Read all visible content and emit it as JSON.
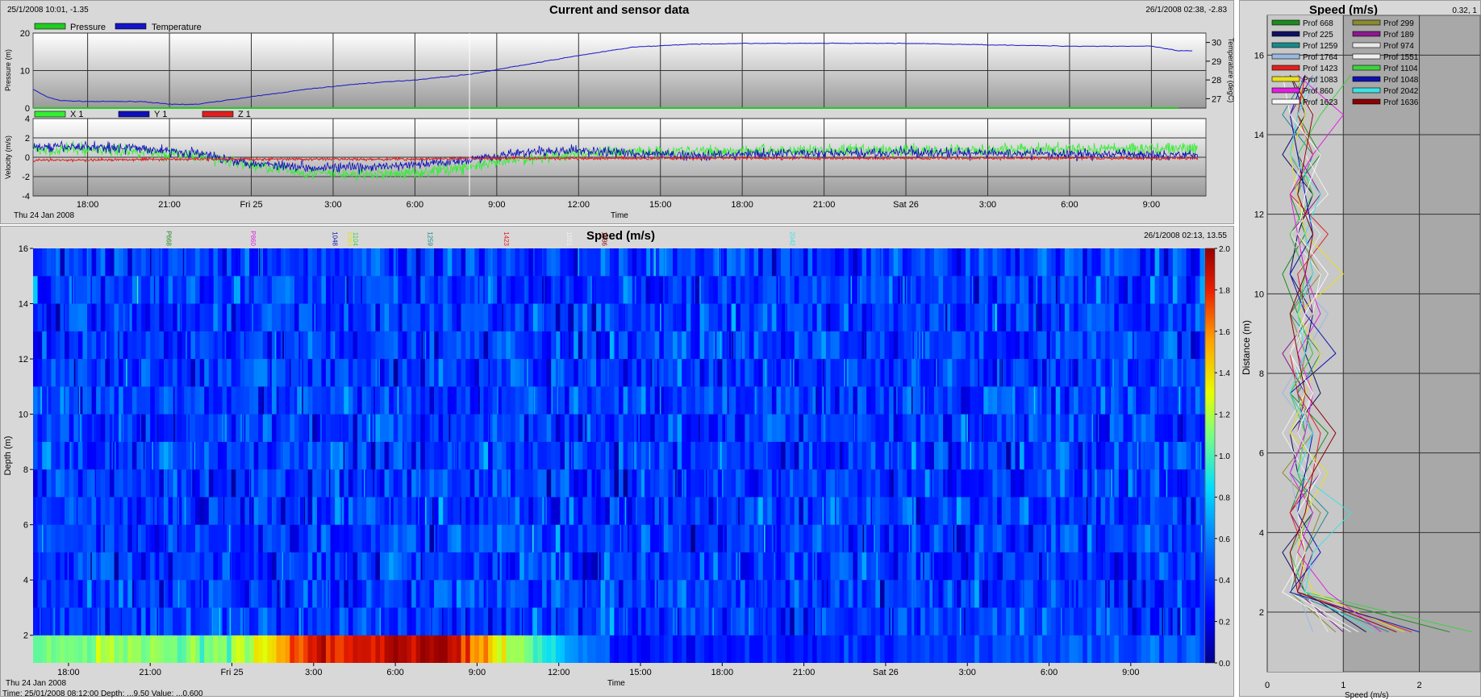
{
  "sensor_panel": {
    "title": "Current and sensor data",
    "readout_left": "25/1/2008 10:01, -1.35",
    "readout_right": "26/1/2008 02:38, -2.83",
    "date_label": "Thu 24 Jan 2008",
    "xlabel": "Time"
  },
  "speed_panel": {
    "title": "Speed (m/s)",
    "readout_right": "26/1/2008 02:13, 13.55",
    "date_label": "Thu 24 Jan 2008",
    "xlabel": "Time",
    "status": "Time: 25/01/2008 08:12:00  Depth: ...9.50  Value: ...0.600"
  },
  "profile_panel": {
    "title": "Speed (m/s)",
    "readout_right": "0.32, 1",
    "xlabel": "Speed (m/s)"
  },
  "colors": {
    "pressure": "#22cc22",
    "temperature": "#1515c8",
    "x1": "#33ee33",
    "y1": "#1010b8",
    "z1": "#e02020"
  },
  "chart_data": [
    {
      "type": "line",
      "name": "pressure-temperature",
      "title": "Current and sensor data",
      "xlabel": "",
      "ylabel": "Pressure (m)",
      "y2label": "Temperature (degC)",
      "ylim": [
        0,
        20
      ],
      "y2lim": [
        26.5,
        30.5
      ],
      "yticks": [
        0,
        10,
        20
      ],
      "y2ticks": [
        27,
        28,
        29,
        30
      ],
      "x_hours": [
        0,
        0.5,
        1,
        2,
        3,
        4,
        5,
        6,
        8,
        10,
        12,
        14,
        16,
        18,
        20,
        22,
        24,
        26,
        28,
        30,
        32,
        34,
        36,
        38,
        40,
        41,
        42
      ],
      "series": [
        {
          "name": "Pressure",
          "values": [
            0,
            0,
            0,
            0,
            0,
            0,
            0,
            0,
            0,
            0,
            0,
            0,
            0,
            0,
            0,
            0,
            0,
            0,
            0,
            0,
            0,
            0,
            0,
            0,
            0,
            0,
            0
          ]
        },
        {
          "name": "Temperature",
          "values": [
            27.5,
            27.1,
            26.9,
            26.85,
            26.85,
            26.85,
            26.7,
            26.7,
            27.1,
            27.5,
            27.8,
            28.0,
            28.3,
            28.8,
            29.3,
            29.75,
            29.9,
            29.95,
            29.95,
            29.95,
            29.95,
            29.9,
            29.85,
            29.8,
            29.8,
            29.8,
            29.55
          ]
        }
      ],
      "legend": "top-left"
    },
    {
      "type": "line",
      "name": "velocity",
      "xlabel": "Time",
      "ylabel": "Velocity (m/s)",
      "ylim": [
        -4,
        4
      ],
      "yticks": [
        -4,
        -2,
        0,
        2,
        4
      ],
      "x_hours": [
        0,
        2,
        4,
        6,
        8,
        10,
        12,
        14,
        16,
        18,
        20,
        22,
        24,
        26,
        28,
        30,
        32,
        34,
        36,
        38,
        40,
        42
      ],
      "x_tick_labels": [
        "18:00",
        "21:00",
        "Fri 25",
        "3:00",
        "6:00",
        "9:00",
        "12:00",
        "15:00",
        "18:00",
        "21:00",
        "Sat 26",
        "3:00",
        "6:00",
        "9:00"
      ],
      "series": [
        {
          "name": "X 1",
          "values": [
            0.8,
            0.8,
            0.6,
            0.1,
            -0.8,
            -1.6,
            -1.8,
            -1.6,
            -1.0,
            -0.2,
            0.4,
            0.6,
            0.6,
            0.7,
            0.7,
            0.7,
            0.7,
            0.8,
            0.8,
            0.8,
            0.9,
            0.9
          ]
        },
        {
          "name": "Y 1",
          "values": [
            1.0,
            1.1,
            0.9,
            0.4,
            -0.6,
            -1.0,
            -1.1,
            -0.8,
            -0.2,
            0.5,
            0.7,
            0.4,
            0.2,
            0.3,
            0.4,
            0.4,
            0.5,
            0.4,
            0.4,
            0.3,
            0.3,
            0.3
          ]
        },
        {
          "name": "Z 1",
          "values": [
            -0.3,
            -0.3,
            -0.2,
            -0.2,
            -0.2,
            -0.2,
            -0.2,
            -0.2,
            -0.1,
            -0.1,
            -0.1,
            -0.1,
            -0.1,
            -0.1,
            -0.1,
            -0.1,
            -0.1,
            -0.1,
            -0.1,
            -0.1,
            -0.1,
            -0.1
          ]
        }
      ],
      "legend": "top-left"
    },
    {
      "type": "heatmap",
      "name": "speed-depth",
      "title": "Speed (m/s)",
      "xlabel": "Time",
      "ylabel": "Depth (m)",
      "ylim": [
        1,
        16
      ],
      "yticks": [
        2,
        4,
        6,
        8,
        10,
        12,
        14,
        16
      ],
      "colorbar": {
        "range": [
          0,
          2
        ],
        "ticks": [
          0.0,
          0.2,
          0.4,
          0.6,
          0.8,
          1.0,
          1.2,
          1.4,
          1.6,
          1.8,
          2.0
        ]
      },
      "x_tick_labels": [
        "18:00",
        "21:00",
        "Fri 25",
        "3:00",
        "6:00",
        "9:00",
        "12:00",
        "15:00",
        "18:00",
        "21:00",
        "Sat 26",
        "3:00",
        "6:00",
        "9:00"
      ],
      "typical_upper_speed": 0.4,
      "bottom_bin_hours": [
        0,
        3,
        6,
        8,
        10,
        13,
        15,
        16,
        18,
        20,
        22,
        26,
        30,
        34,
        38,
        42
      ],
      "bottom_bin_speed": [
        1.1,
        1.15,
        1.05,
        1.2,
        1.75,
        1.95,
        1.95,
        1.7,
        1.1,
        0.6,
        0.3,
        0.3,
        0.35,
        0.4,
        0.45,
        0.5
      ],
      "profile_markers": [
        {
          "label": "P668",
          "hour": 4.9,
          "color": "#1e8a1e"
        },
        {
          "label": "P860",
          "hour": 8.0,
          "color": "#e020e0"
        },
        {
          "label": "1048",
          "hour": 11.0,
          "color": "#1010b0"
        },
        {
          "label": "1083",
          "hour": 11.55,
          "color": "#e8e020"
        },
        {
          "label": "1104",
          "hour": 11.75,
          "color": "#40d040"
        },
        {
          "label": "1259",
          "hour": 14.5,
          "color": "#1a8a8a"
        },
        {
          "label": "1423",
          "hour": 17.3,
          "color": "#e02020"
        },
        {
          "label": "1551",
          "hour": 19.6,
          "color": "#f0f0f0"
        },
        {
          "label": "1636",
          "hour": 20.9,
          "color": "#8b0000"
        },
        {
          "label": "2042",
          "hour": 27.8,
          "color": "#40e0e0"
        }
      ]
    },
    {
      "type": "line",
      "name": "speed-profiles",
      "title": "Speed (m/s)",
      "xlabel": "Speed (m/s)",
      "ylabel": "Distance (m)",
      "xlim": [
        0,
        2.8
      ],
      "ylim": [
        0.5,
        17
      ],
      "xticks": [
        0,
        1,
        2
      ],
      "yticks": [
        2,
        4,
        6,
        8,
        10,
        12,
        14,
        16
      ],
      "y": [
        1.5,
        2.5,
        3.5,
        4.5,
        5.5,
        6.5,
        7.5,
        8.5,
        9.5,
        10.5,
        11.5,
        12.5,
        13.5,
        14.5,
        15.5
      ],
      "series": [
        {
          "name": "Prof 668",
          "color": "#1e8a1e",
          "values": [
            2.4,
            0.4,
            0.6,
            0.3,
            0.5,
            0.8,
            0.3,
            0.6,
            0.4,
            0.2,
            0.5,
            0.3,
            0.7,
            0.4,
            0.5
          ]
        },
        {
          "name": "Prof 299",
          "color": "#8a8a30",
          "values": [
            0.9,
            0.3,
            0.5,
            0.7,
            0.2,
            0.6,
            0.4,
            0.5,
            0.3,
            0.7,
            0.4,
            0.6,
            0.3,
            0.5,
            0.4
          ]
        },
        {
          "name": "Prof 225",
          "color": "#101060",
          "values": [
            1.3,
            0.5,
            0.2,
            0.6,
            0.4,
            0.3,
            0.7,
            0.5,
            0.6,
            0.3,
            0.4,
            0.6,
            0.2,
            0.5,
            0.3
          ]
        },
        {
          "name": "Prof 189",
          "color": "#8a1a8a",
          "values": [
            1.0,
            0.4,
            0.6,
            0.3,
            0.7,
            0.4,
            0.5,
            0.2,
            0.6,
            0.5,
            0.3,
            0.7,
            0.4,
            0.3,
            0.6
          ]
        },
        {
          "name": "Prof 1259",
          "color": "#1a8a8a",
          "values": [
            1.6,
            0.3,
            0.5,
            0.8,
            0.3,
            0.5,
            0.4,
            0.7,
            0.3,
            0.6,
            0.5,
            0.4,
            0.6,
            0.2,
            0.5
          ]
        },
        {
          "name": "Prof 974",
          "color": "#e8e8e8",
          "values": [
            0.8,
            0.5,
            0.3,
            0.5,
            0.6,
            0.3,
            0.6,
            0.4,
            0.5,
            0.4,
            0.7,
            0.3,
            0.5,
            0.6,
            0.4
          ]
        },
        {
          "name": "Prof 1764",
          "color": "#9ab8e0",
          "values": [
            0.6,
            0.4,
            0.7,
            0.4,
            0.3,
            0.6,
            0.2,
            0.5,
            0.8,
            0.3,
            0.6,
            0.5,
            0.3,
            0.4,
            0.7
          ]
        },
        {
          "name": "Prof 1551",
          "color": "#f0f0f0",
          "values": [
            1.2,
            0.3,
            0.4,
            0.6,
            0.5,
            0.2,
            0.5,
            0.3,
            0.6,
            0.7,
            0.3,
            0.8,
            0.5,
            0.6,
            0.3
          ]
        },
        {
          "name": "Prof 1423",
          "color": "#e02020",
          "values": [
            1.9,
            0.4,
            0.5,
            0.3,
            0.6,
            0.7,
            0.4,
            0.3,
            0.5,
            0.4,
            0.8,
            0.3,
            0.6,
            0.4,
            0.5
          ]
        },
        {
          "name": "Prof 1104",
          "color": "#40d040",
          "values": [
            2.7,
            0.5,
            0.3,
            0.6,
            0.4,
            0.5,
            0.3,
            0.6,
            0.4,
            0.5,
            0.3,
            0.6,
            0.4,
            0.7,
            1.1
          ]
        },
        {
          "name": "Prof 1083",
          "color": "#e8e020",
          "values": [
            1.8,
            0.6,
            0.4,
            0.5,
            0.8,
            0.3,
            0.5,
            0.7,
            0.4,
            1.0,
            0.5,
            0.4,
            0.3,
            0.5,
            0.4
          ]
        },
        {
          "name": "Prof 1048",
          "color": "#1010b0",
          "values": [
            2.0,
            0.3,
            0.7,
            0.4,
            0.5,
            0.6,
            0.3,
            0.9,
            0.5,
            0.3,
            0.6,
            0.5,
            0.4,
            0.3,
            0.5
          ]
        },
        {
          "name": "Prof 860",
          "color": "#e020e0",
          "values": [
            1.5,
            0.8,
            0.4,
            0.6,
            0.3,
            0.5,
            0.6,
            0.4,
            0.7,
            0.5,
            0.4,
            0.3,
            0.6,
            1.0,
            0.4
          ]
        },
        {
          "name": "Prof 2042",
          "color": "#40e0e0",
          "values": [
            1.4,
            0.5,
            0.6,
            1.1,
            0.4,
            0.6,
            0.3,
            0.5,
            0.4,
            0.6,
            0.5,
            0.7,
            0.3,
            0.4,
            0.6
          ]
        },
        {
          "name": "Prof 1623",
          "color": "#f8f8f8",
          "values": [
            1.1,
            0.2,
            0.5,
            0.4,
            0.7,
            0.4,
            0.6,
            0.3,
            0.5,
            0.8,
            0.4,
            0.5,
            0.7,
            0.3,
            0.2
          ]
        },
        {
          "name": "Prof 1636",
          "color": "#8b0000",
          "values": [
            1.7,
            0.4,
            0.3,
            0.5,
            0.6,
            0.9,
            0.5,
            0.4,
            0.3,
            0.5,
            0.6,
            0.4,
            0.5,
            0.6,
            0.3
          ]
        }
      ],
      "legend": "top-left"
    }
  ]
}
